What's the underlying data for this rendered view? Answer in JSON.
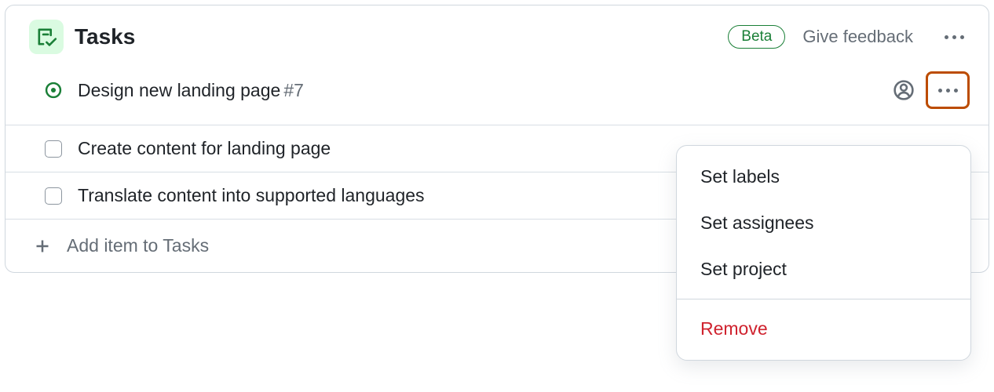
{
  "header": {
    "title": "Tasks",
    "badge": "Beta",
    "feedback": "Give feedback"
  },
  "tasks": [
    {
      "title": "Design new landing page",
      "issue": "#7"
    },
    {
      "title": "Create content for landing page"
    },
    {
      "title": "Translate content into supported languages"
    }
  ],
  "add_row": "Add item to Tasks",
  "dropdown": {
    "set_labels": "Set labels",
    "set_assignees": "Set assignees",
    "set_project": "Set project",
    "remove": "Remove"
  }
}
